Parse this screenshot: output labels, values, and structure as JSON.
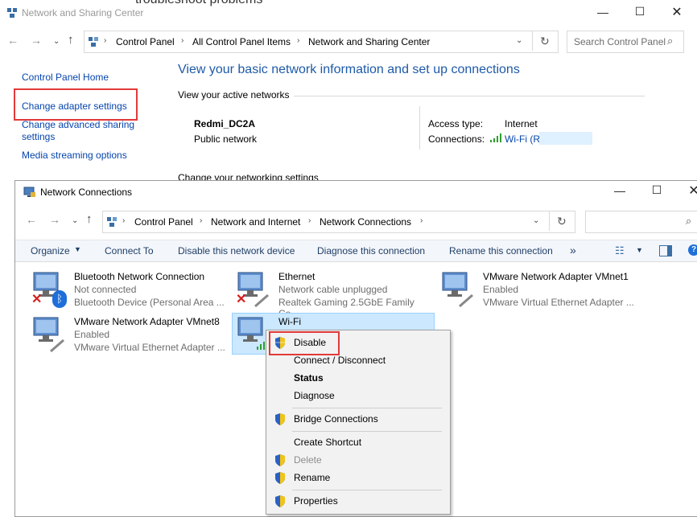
{
  "nsc": {
    "title": "Network and Sharing Center",
    "title_fragment": "troubleshoot problems",
    "address": [
      "Control Panel",
      "All Control Panel Items",
      "Network and Sharing Center"
    ],
    "search_placeholder": "Search Control Panel",
    "heading": "View your basic network information and set up connections",
    "active_label": "View your active networks",
    "network_name": "Redmi_DC2A",
    "network_type": "Public network",
    "access_type_label": "Access type:",
    "access_type_value": "Internet",
    "connections_label": "Connections:",
    "connections_value": "Wi-Fi (R",
    "change_settings_fragment": "Change your networking settings",
    "sidebar": {
      "home": "Control Panel Home",
      "adapter": "Change adapter settings",
      "advanced_1": "Change advanced sharing",
      "advanced_2": "settings",
      "media": "Media streaming options"
    }
  },
  "nc": {
    "title": "Network Connections",
    "address": [
      "Control Panel",
      "Network and Internet",
      "Network Connections"
    ],
    "commands": {
      "organize": "Organize",
      "connect_to": "Connect To",
      "disable_device": "Disable this network device",
      "diagnose": "Diagnose this connection",
      "rename": "Rename this connection",
      "more": "»"
    },
    "items": [
      {
        "name": "Bluetooth Network Connection",
        "status": "Not connected",
        "device": "Bluetooth Device (Personal Area ..."
      },
      {
        "name": "Ethernet",
        "status": "Network cable unplugged",
        "device": "Realtek Gaming 2.5GbE Family Co..."
      },
      {
        "name": "VMware Network Adapter VMnet1",
        "status": "Enabled",
        "device": "VMware Virtual Ethernet Adapter ..."
      },
      {
        "name": "VMware Network Adapter VMnet8",
        "status": "Enabled",
        "device": "VMware Virtual Ethernet Adapter ..."
      },
      {
        "name": "Wi-Fi",
        "status": "",
        "device": ""
      }
    ]
  },
  "menu": {
    "disable": "Disable",
    "connect": "Connect / Disconnect",
    "status": "Status",
    "diagnose": "Diagnose",
    "bridge": "Bridge Connections",
    "shortcut": "Create Shortcut",
    "delete": "Delete",
    "rename": "Rename",
    "properties": "Properties"
  },
  "colors": {
    "link": "#0645ad",
    "highlight": "#e23a3a",
    "selection": "#cce8ff",
    "heading": "#1e5aa8"
  }
}
